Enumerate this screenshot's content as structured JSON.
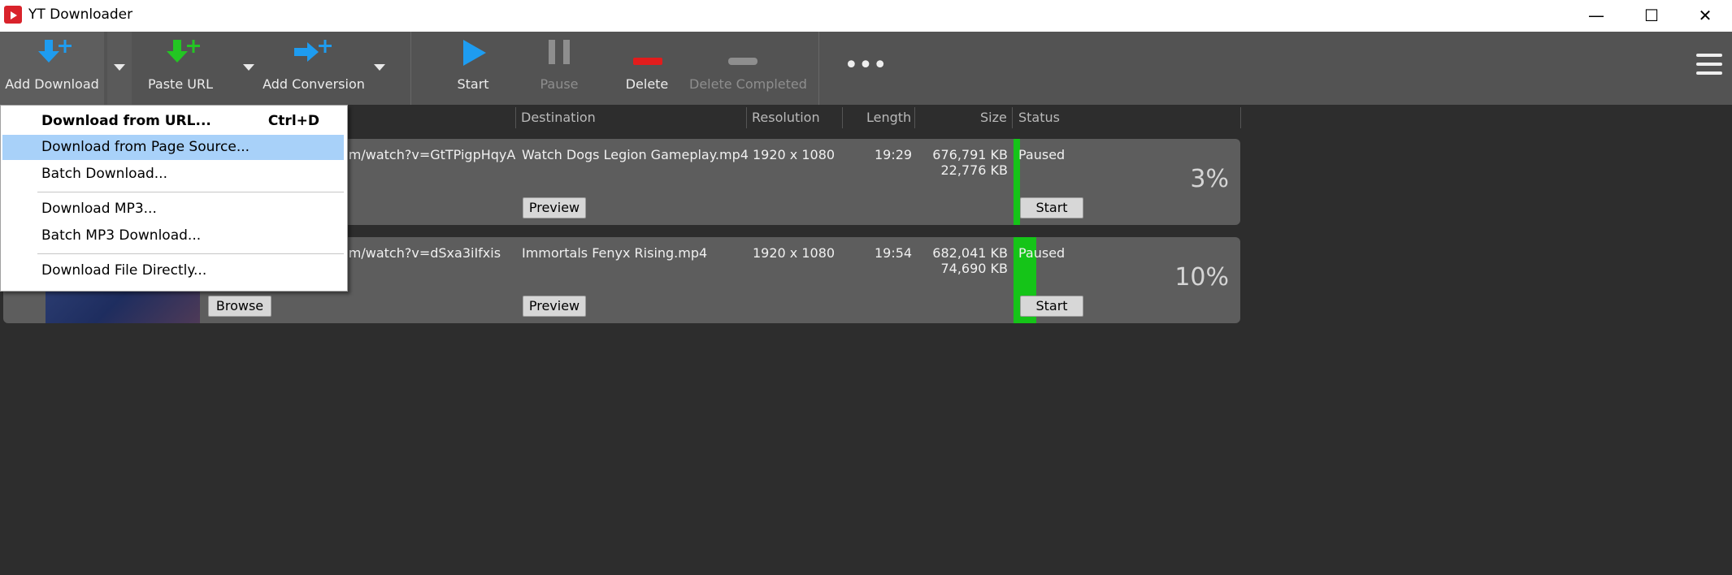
{
  "app": {
    "title": "YT Downloader"
  },
  "window": {
    "minimize": "—",
    "maximize": "☐",
    "close": "✕"
  },
  "toolbar": {
    "add_download": "Add Download",
    "paste_url": "Paste URL",
    "add_conversion": "Add Conversion",
    "start": "Start",
    "pause": "Pause",
    "delete": "Delete",
    "delete_completed": "Delete Completed",
    "more": "•••"
  },
  "colors": {
    "accent_blue": "#1e9cf0",
    "accent_green": "#23c623",
    "delete_red": "#e21c1c",
    "progress_green": "#15c418"
  },
  "columns": {
    "destination": "Destination",
    "resolution": "Resolution",
    "length": "Length",
    "size": "Size",
    "status": "Status"
  },
  "downloads": [
    {
      "url": "om/watch?v=GtTPigpHqyA",
      "destination": "Watch Dogs  Legion Gameplay.mp4",
      "resolution": "1920 x 1080",
      "length": "19:29",
      "size_total": "676,791 KB",
      "size_done": "22,776 KB",
      "status": "Paused",
      "progress": "3%",
      "progress_value": 0.03,
      "preview": "Preview",
      "start": "Start"
    },
    {
      "url": "om/watch?v=dSxa3iIfxis",
      "destination": "Immortals Fenyx Rising.mp4",
      "resolution": "1920 x 1080",
      "length": "19:54",
      "size_total": "682,041 KB",
      "size_done": "74,690 KB",
      "status": "Paused",
      "progress": "10%",
      "progress_value": 0.1,
      "preview": "Preview",
      "start": "Start",
      "browse": "Browse"
    }
  ],
  "menu": {
    "items": [
      {
        "label": "Download from URL...",
        "shortcut": "Ctrl+D"
      },
      {
        "label": "Download from Page Source..."
      },
      {
        "label": "Batch Download..."
      },
      {
        "label": "Download MP3..."
      },
      {
        "label": "Batch MP3 Download..."
      },
      {
        "label": "Download File Directly..."
      }
    ]
  }
}
